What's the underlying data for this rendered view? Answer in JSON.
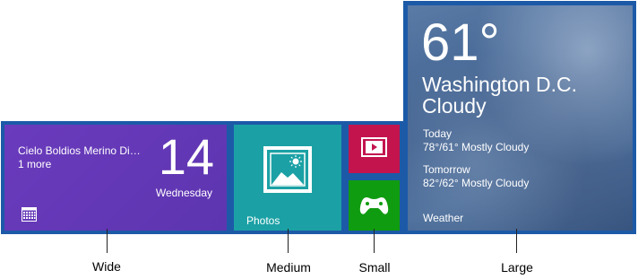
{
  "tiles": {
    "wide": {
      "app": "calendar",
      "event": "Cielo Boldios Merino Dia...",
      "more": "1 more",
      "day_number": "14",
      "weekday": "Wednesday",
      "color": "#6a3bbd",
      "icon": "calendar-icon"
    },
    "medium": {
      "label": "Photos",
      "color": "#1ba1a5",
      "icon": "photo-icon"
    },
    "small": [
      {
        "app": "video",
        "color": "#c3144e",
        "icon": "video-icon"
      },
      {
        "app": "games",
        "color": "#109c10",
        "icon": "xbox-controller-icon"
      }
    ],
    "large": {
      "temperature": "61°",
      "city": "Washington D.C.",
      "condition": "Cloudy",
      "forecast": [
        {
          "day": "Today",
          "detail": "78°/61° Mostly Cloudy"
        },
        {
          "day": "Tomorrow",
          "detail": "82°/62° Mostly Cloudy"
        }
      ],
      "label": "Weather"
    }
  },
  "frame_color": "#1c5aa8",
  "captions": {
    "wide": "Wide",
    "medium": "Medium",
    "small": "Small",
    "large": "Large"
  }
}
